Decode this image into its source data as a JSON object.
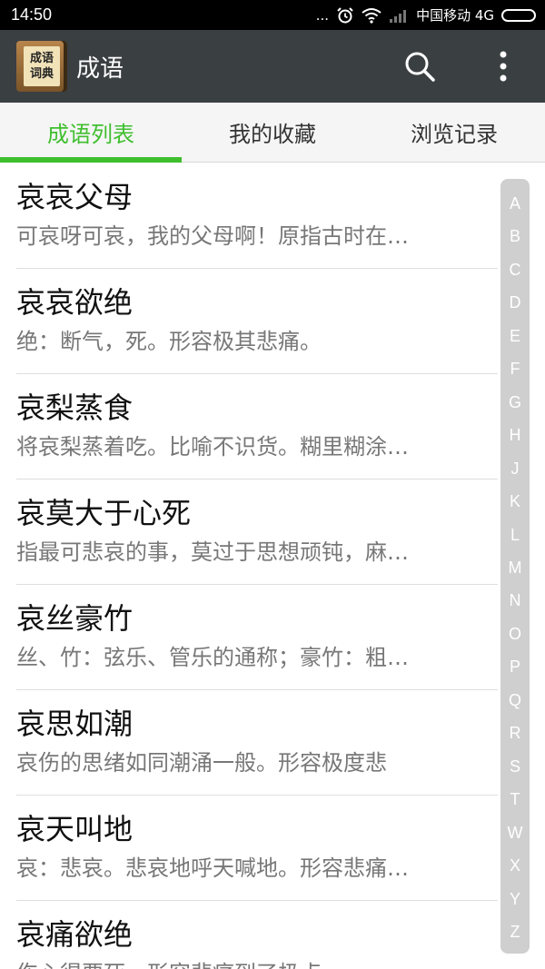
{
  "status_bar": {
    "time": "14:50",
    "dots": "...",
    "carrier": "中国移动 4G"
  },
  "app_bar": {
    "logo_line1": "成语",
    "logo_line2": "词典",
    "title": "成语"
  },
  "tabs": [
    {
      "label": "成语列表",
      "active": true
    },
    {
      "label": "我的收藏",
      "active": false
    },
    {
      "label": "浏览记录",
      "active": false
    }
  ],
  "items": [
    {
      "title": "哀哀父母",
      "desc": "可哀呀可哀，我的父母啊！原指古时在…"
    },
    {
      "title": "哀哀欲绝",
      "desc": "绝：断气，死。形容极其悲痛。"
    },
    {
      "title": "哀梨蒸食",
      "desc": "将哀梨蒸着吃。比喻不识货。糊里糊涂…"
    },
    {
      "title": "哀莫大于心死",
      "desc": "指最可悲哀的事，莫过于思想顽钝，麻…"
    },
    {
      "title": "哀丝豪竹",
      "desc": "丝、竹：弦乐、管乐的通称；豪竹：粗…"
    },
    {
      "title": "哀思如潮",
      "desc": "哀伤的思绪如同潮涌一般。形容极度悲"
    },
    {
      "title": "哀天叫地",
      "desc": "哀：悲哀。悲哀地呼天喊地。形容悲痛…"
    },
    {
      "title": "哀痛欲绝",
      "desc": "伤心得要死。形容悲痛到了极点。"
    }
  ],
  "alpha_index": [
    "A",
    "B",
    "C",
    "D",
    "E",
    "F",
    "G",
    "H",
    "J",
    "K",
    "L",
    "M",
    "N",
    "O",
    "P",
    "Q",
    "R",
    "S",
    "T",
    "W",
    "X",
    "Y",
    "Z"
  ],
  "colors": {
    "accent": "#3fbf2e",
    "app_bar": "#3a3f42"
  }
}
